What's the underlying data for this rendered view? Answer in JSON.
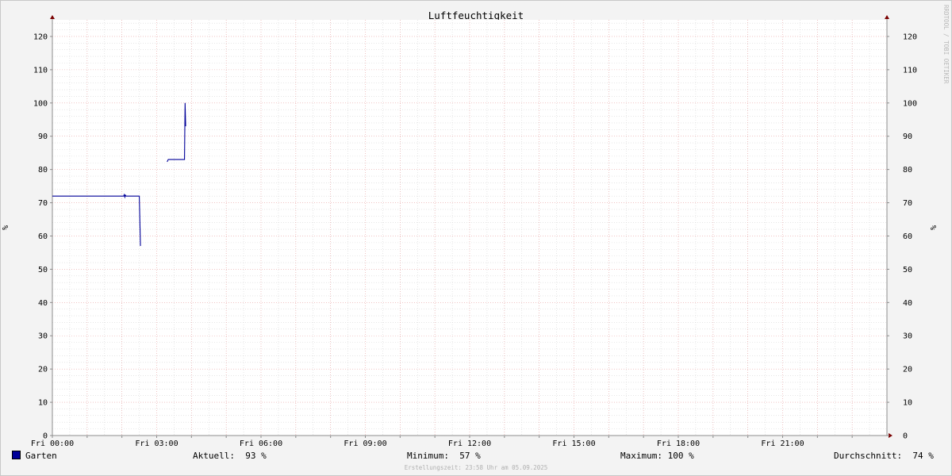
{
  "chart_data": {
    "type": "line",
    "title": "Luftfeuchtigkeit",
    "ylabel": "%",
    "ylim": [
      0,
      125
    ],
    "yticks": [
      0,
      10,
      20,
      30,
      40,
      50,
      60,
      70,
      80,
      90,
      100,
      110,
      120
    ],
    "xlim": [
      "Fri 00:00",
      "Sat 00:00"
    ],
    "xtick_labels": [
      "Fri 00:00",
      "Fri 03:00",
      "Fri 06:00",
      "Fri 09:00",
      "Fri 12:00",
      "Fri 15:00",
      "Fri 18:00",
      "Fri 21:00"
    ],
    "grid": true,
    "series": [
      {
        "name": "Garten",
        "color": "#000099",
        "segments": [
          [
            [
              "Fri 00:00",
              72
            ],
            [
              "Fri 02:03",
              72
            ],
            [
              "Fri 02:04",
              72.4
            ],
            [
              "Fri 02:05",
              71.7
            ],
            [
              "Fri 02:06",
              72.3
            ],
            [
              "Fri 02:07",
              72
            ],
            [
              "Fri 02:30",
              72
            ],
            [
              "Fri 02:32",
              57
            ]
          ],
          [
            [
              "Fri 03:18",
              82.3
            ],
            [
              "Fri 03:20",
              83
            ],
            [
              "Fri 03:48",
              83
            ],
            [
              "Fri 03:49",
              100
            ],
            [
              "Fri 03:50",
              93
            ]
          ]
        ]
      }
    ]
  },
  "legend": {
    "series_name": "Garten",
    "series_color": "#000099",
    "current_label": "Aktuell:",
    "current_value": "93 %",
    "min_label": "Minimum:",
    "min_value": "57 %",
    "max_label": "Maximum:",
    "max_value": "100 %",
    "avg_label": "Durchschnitt:",
    "avg_value": "74 %"
  },
  "watermark": "RRDTOOL / TOBI OETIKER",
  "footer": "Erstellungszeit: 23:58 Uhr am 05.09.2025"
}
